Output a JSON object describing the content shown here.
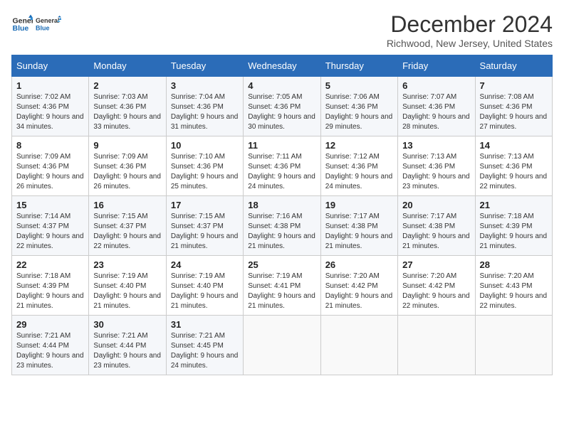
{
  "logo": {
    "line1": "General",
    "line2": "Blue"
  },
  "title": "December 2024",
  "location": "Richwood, New Jersey, United States",
  "days_of_week": [
    "Sunday",
    "Monday",
    "Tuesday",
    "Wednesday",
    "Thursday",
    "Friday",
    "Saturday"
  ],
  "weeks": [
    [
      {
        "num": "1",
        "sunrise": "7:02 AM",
        "sunset": "4:36 PM",
        "daylight": "9 hours and 34 minutes."
      },
      {
        "num": "2",
        "sunrise": "7:03 AM",
        "sunset": "4:36 PM",
        "daylight": "9 hours and 33 minutes."
      },
      {
        "num": "3",
        "sunrise": "7:04 AM",
        "sunset": "4:36 PM",
        "daylight": "9 hours and 31 minutes."
      },
      {
        "num": "4",
        "sunrise": "7:05 AM",
        "sunset": "4:36 PM",
        "daylight": "9 hours and 30 minutes."
      },
      {
        "num": "5",
        "sunrise": "7:06 AM",
        "sunset": "4:36 PM",
        "daylight": "9 hours and 29 minutes."
      },
      {
        "num": "6",
        "sunrise": "7:07 AM",
        "sunset": "4:36 PM",
        "daylight": "9 hours and 28 minutes."
      },
      {
        "num": "7",
        "sunrise": "7:08 AM",
        "sunset": "4:36 PM",
        "daylight": "9 hours and 27 minutes."
      }
    ],
    [
      {
        "num": "8",
        "sunrise": "7:09 AM",
        "sunset": "4:36 PM",
        "daylight": "9 hours and 26 minutes."
      },
      {
        "num": "9",
        "sunrise": "7:09 AM",
        "sunset": "4:36 PM",
        "daylight": "9 hours and 26 minutes."
      },
      {
        "num": "10",
        "sunrise": "7:10 AM",
        "sunset": "4:36 PM",
        "daylight": "9 hours and 25 minutes."
      },
      {
        "num": "11",
        "sunrise": "7:11 AM",
        "sunset": "4:36 PM",
        "daylight": "9 hours and 24 minutes."
      },
      {
        "num": "12",
        "sunrise": "7:12 AM",
        "sunset": "4:36 PM",
        "daylight": "9 hours and 24 minutes."
      },
      {
        "num": "13",
        "sunrise": "7:13 AM",
        "sunset": "4:36 PM",
        "daylight": "9 hours and 23 minutes."
      },
      {
        "num": "14",
        "sunrise": "7:13 AM",
        "sunset": "4:36 PM",
        "daylight": "9 hours and 22 minutes."
      }
    ],
    [
      {
        "num": "15",
        "sunrise": "7:14 AM",
        "sunset": "4:37 PM",
        "daylight": "9 hours and 22 minutes."
      },
      {
        "num": "16",
        "sunrise": "7:15 AM",
        "sunset": "4:37 PM",
        "daylight": "9 hours and 22 minutes."
      },
      {
        "num": "17",
        "sunrise": "7:15 AM",
        "sunset": "4:37 PM",
        "daylight": "9 hours and 21 minutes."
      },
      {
        "num": "18",
        "sunrise": "7:16 AM",
        "sunset": "4:38 PM",
        "daylight": "9 hours and 21 minutes."
      },
      {
        "num": "19",
        "sunrise": "7:17 AM",
        "sunset": "4:38 PM",
        "daylight": "9 hours and 21 minutes."
      },
      {
        "num": "20",
        "sunrise": "7:17 AM",
        "sunset": "4:38 PM",
        "daylight": "9 hours and 21 minutes."
      },
      {
        "num": "21",
        "sunrise": "7:18 AM",
        "sunset": "4:39 PM",
        "daylight": "9 hours and 21 minutes."
      }
    ],
    [
      {
        "num": "22",
        "sunrise": "7:18 AM",
        "sunset": "4:39 PM",
        "daylight": "9 hours and 21 minutes."
      },
      {
        "num": "23",
        "sunrise": "7:19 AM",
        "sunset": "4:40 PM",
        "daylight": "9 hours and 21 minutes."
      },
      {
        "num": "24",
        "sunrise": "7:19 AM",
        "sunset": "4:40 PM",
        "daylight": "9 hours and 21 minutes."
      },
      {
        "num": "25",
        "sunrise": "7:19 AM",
        "sunset": "4:41 PM",
        "daylight": "9 hours and 21 minutes."
      },
      {
        "num": "26",
        "sunrise": "7:20 AM",
        "sunset": "4:42 PM",
        "daylight": "9 hours and 21 minutes."
      },
      {
        "num": "27",
        "sunrise": "7:20 AM",
        "sunset": "4:42 PM",
        "daylight": "9 hours and 22 minutes."
      },
      {
        "num": "28",
        "sunrise": "7:20 AM",
        "sunset": "4:43 PM",
        "daylight": "9 hours and 22 minutes."
      }
    ],
    [
      {
        "num": "29",
        "sunrise": "7:21 AM",
        "sunset": "4:44 PM",
        "daylight": "9 hours and 23 minutes."
      },
      {
        "num": "30",
        "sunrise": "7:21 AM",
        "sunset": "4:44 PM",
        "daylight": "9 hours and 23 minutes."
      },
      {
        "num": "31",
        "sunrise": "7:21 AM",
        "sunset": "4:45 PM",
        "daylight": "9 hours and 24 minutes."
      },
      null,
      null,
      null,
      null
    ]
  ],
  "colors": {
    "header_bg": "#2b6cb8",
    "odd_row": "#f5f7fa",
    "even_row": "#ffffff"
  }
}
